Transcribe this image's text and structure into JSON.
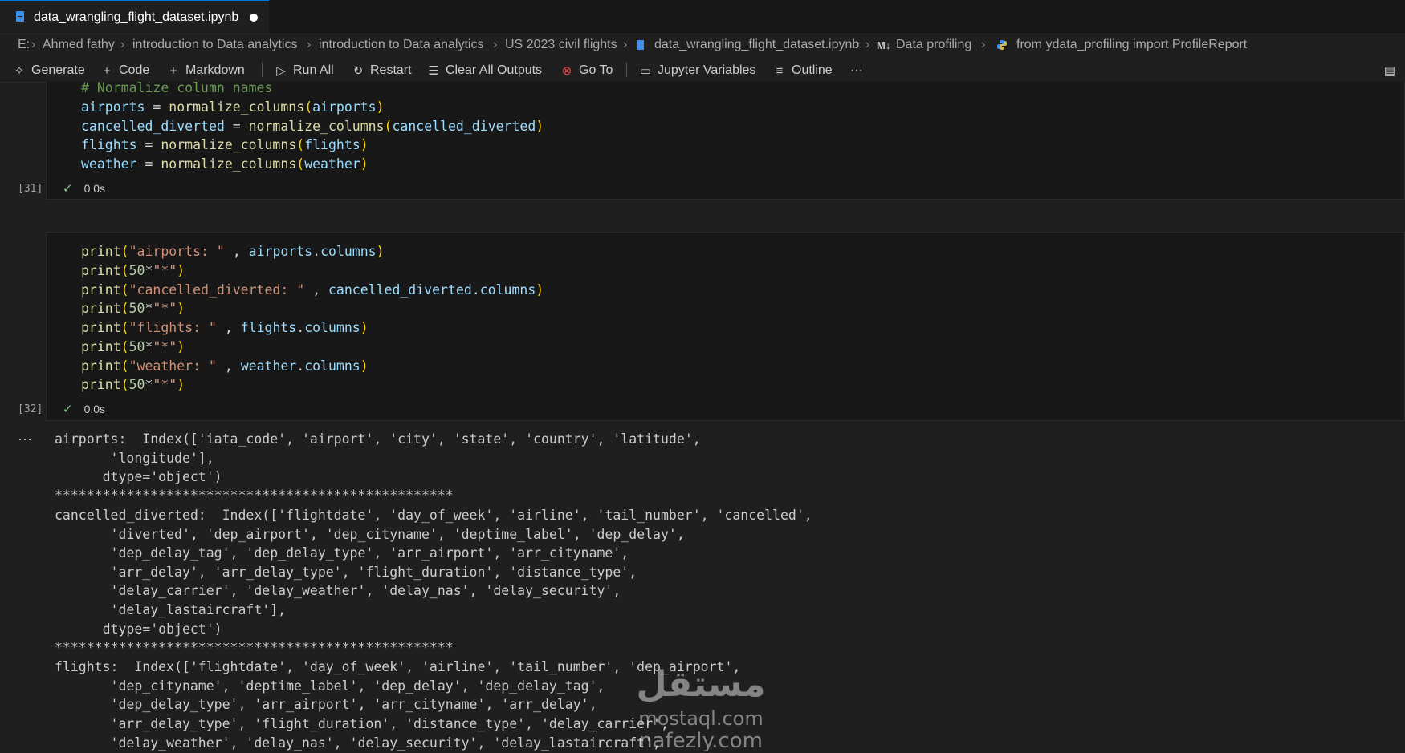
{
  "tab": {
    "title": "data_wrangling_flight_dataset.ipynb"
  },
  "breadcrumb": {
    "drive": "E:",
    "items": [
      "Ahmed fathy",
      "introduction to Data analytics",
      "introduction to Data analytics",
      "US 2023 civil flights",
      "data_wrangling_flight_dataset.ipynb",
      "Data profiling",
      "from ydata_profiling import ProfileReport"
    ],
    "md_badge": "M↓"
  },
  "toolbar": {
    "generate": "Generate",
    "code": "Code",
    "markdown": "Markdown",
    "run_all": "Run All",
    "restart": "Restart",
    "clear_all": "Clear All Outputs",
    "go_to": "Go To",
    "variables": "Jupyter Variables",
    "outline": "Outline",
    "more": "···"
  },
  "cell31": {
    "lines": [
      "# Normalize column names",
      "airports = normalize_columns(airports)",
      "cancelled_diverted = normalize_columns(cancelled_diverted)",
      "flights = normalize_columns(flights)",
      "weather = normalize_columns(weather)"
    ],
    "exec": "[31]",
    "time": "0.0s"
  },
  "cell32": {
    "lines": [
      "print(\"airports: \" , airports.columns)",
      "print(50*\"*\")",
      "print(\"cancelled_diverted: \" , cancelled_diverted.columns)",
      "print(50*\"*\")",
      "print(\"flights: \" , flights.columns)",
      "print(50*\"*\")",
      "print(\"weather: \" , weather.columns)",
      "print(50*\"*\")"
    ],
    "exec": "[32]",
    "time": "0.0s"
  },
  "output": {
    "dots": "···",
    "lines": [
      "airports:  Index(['iata_code', 'airport', 'city', 'state', 'country', 'latitude',",
      "       'longitude'],",
      "      dtype='object')",
      "**************************************************",
      "cancelled_diverted:  Index(['flightdate', 'day_of_week', 'airline', 'tail_number', 'cancelled',",
      "       'diverted', 'dep_airport', 'dep_cityname', 'deptime_label', 'dep_delay',",
      "       'dep_delay_tag', 'dep_delay_type', 'arr_airport', 'arr_cityname',",
      "       'arr_delay', 'arr_delay_type', 'flight_duration', 'distance_type',",
      "       'delay_carrier', 'delay_weather', 'delay_nas', 'delay_security',",
      "       'delay_lastaircraft'],",
      "      dtype='object')",
      "**************************************************",
      "flights:  Index(['flightdate', 'day_of_week', 'airline', 'tail_number', 'dep_airport',",
      "       'dep_cityname', 'deptime_label', 'dep_delay', 'dep_delay_tag',",
      "       'dep_delay_type', 'arr_airport', 'arr_cityname', 'arr_delay',",
      "       'arr_delay_type', 'flight_duration', 'distance_type', 'delay_carrier',",
      "       'delay_weather', 'delay_nas', 'delay_security', 'delay_lastaircraft',"
    ]
  },
  "watermark": {
    "line1": "مستقل",
    "line2": "mostaql.com",
    "line3": "nafezly.com"
  }
}
